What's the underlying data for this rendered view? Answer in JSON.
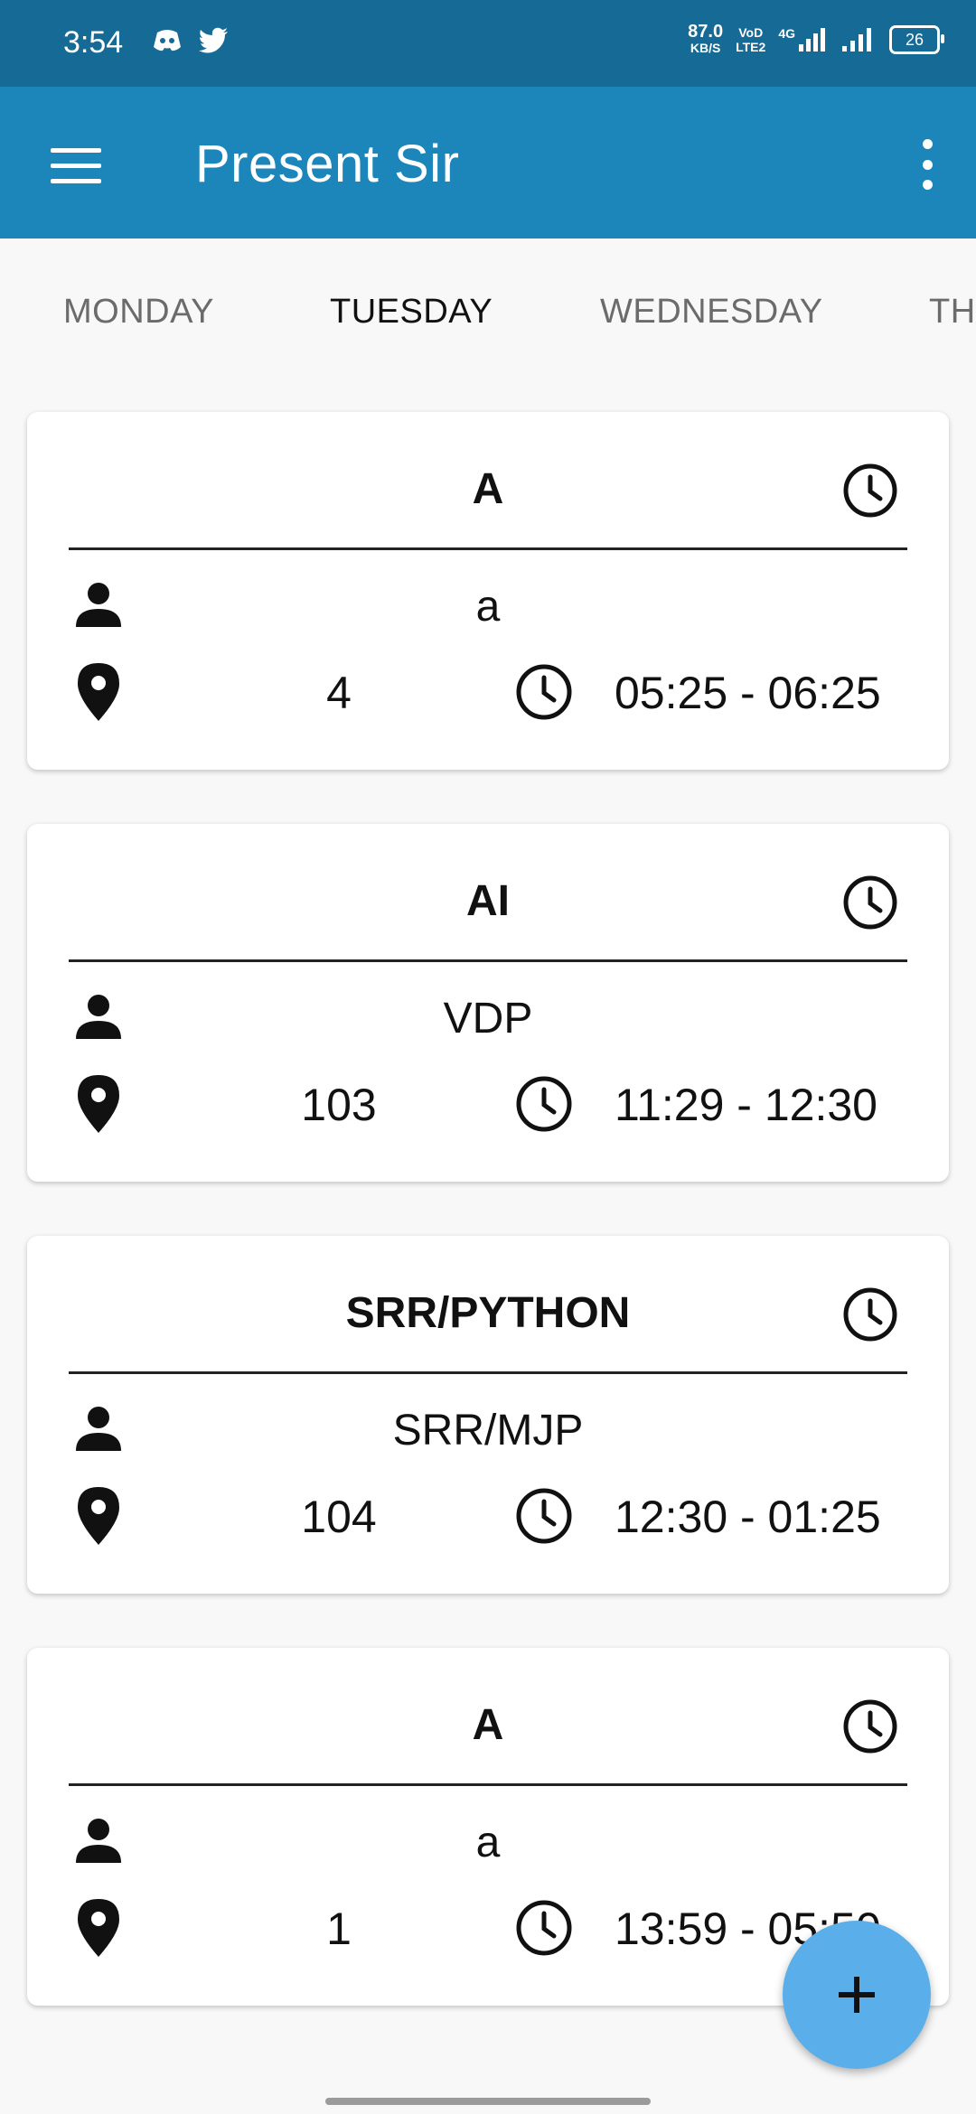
{
  "status_bar": {
    "time": "3:54",
    "net_speed": "87.0",
    "net_unit": "KB/S",
    "volte_top": "VoD",
    "volte_bottom": "LTE2",
    "signal_label": "4G",
    "battery": "26"
  },
  "app_bar": {
    "title": "Present Sir",
    "background_color": "#1c86ba"
  },
  "tabs": [
    {
      "label": "MONDAY",
      "active": false
    },
    {
      "label": "TUESDAY",
      "active": true
    },
    {
      "label": "WEDNESDAY",
      "active": false
    },
    {
      "label": "TH",
      "active": false
    }
  ],
  "classes": [
    {
      "subject": "A",
      "teacher": "a",
      "room": "4",
      "time": "05:25 - 06:25"
    },
    {
      "subject": "AI",
      "teacher": "VDP",
      "room": "103",
      "time": "11:29 - 12:30"
    },
    {
      "subject": "SRR/PYTHON",
      "teacher": "SRR/MJP",
      "room": "104",
      "time": "12:30 - 01:25"
    },
    {
      "subject": "A",
      "teacher": "a",
      "room": "1",
      "time": "13:59 - 05:50"
    }
  ],
  "fab": {
    "icon": "plus-icon",
    "color": "#5aaeea"
  }
}
